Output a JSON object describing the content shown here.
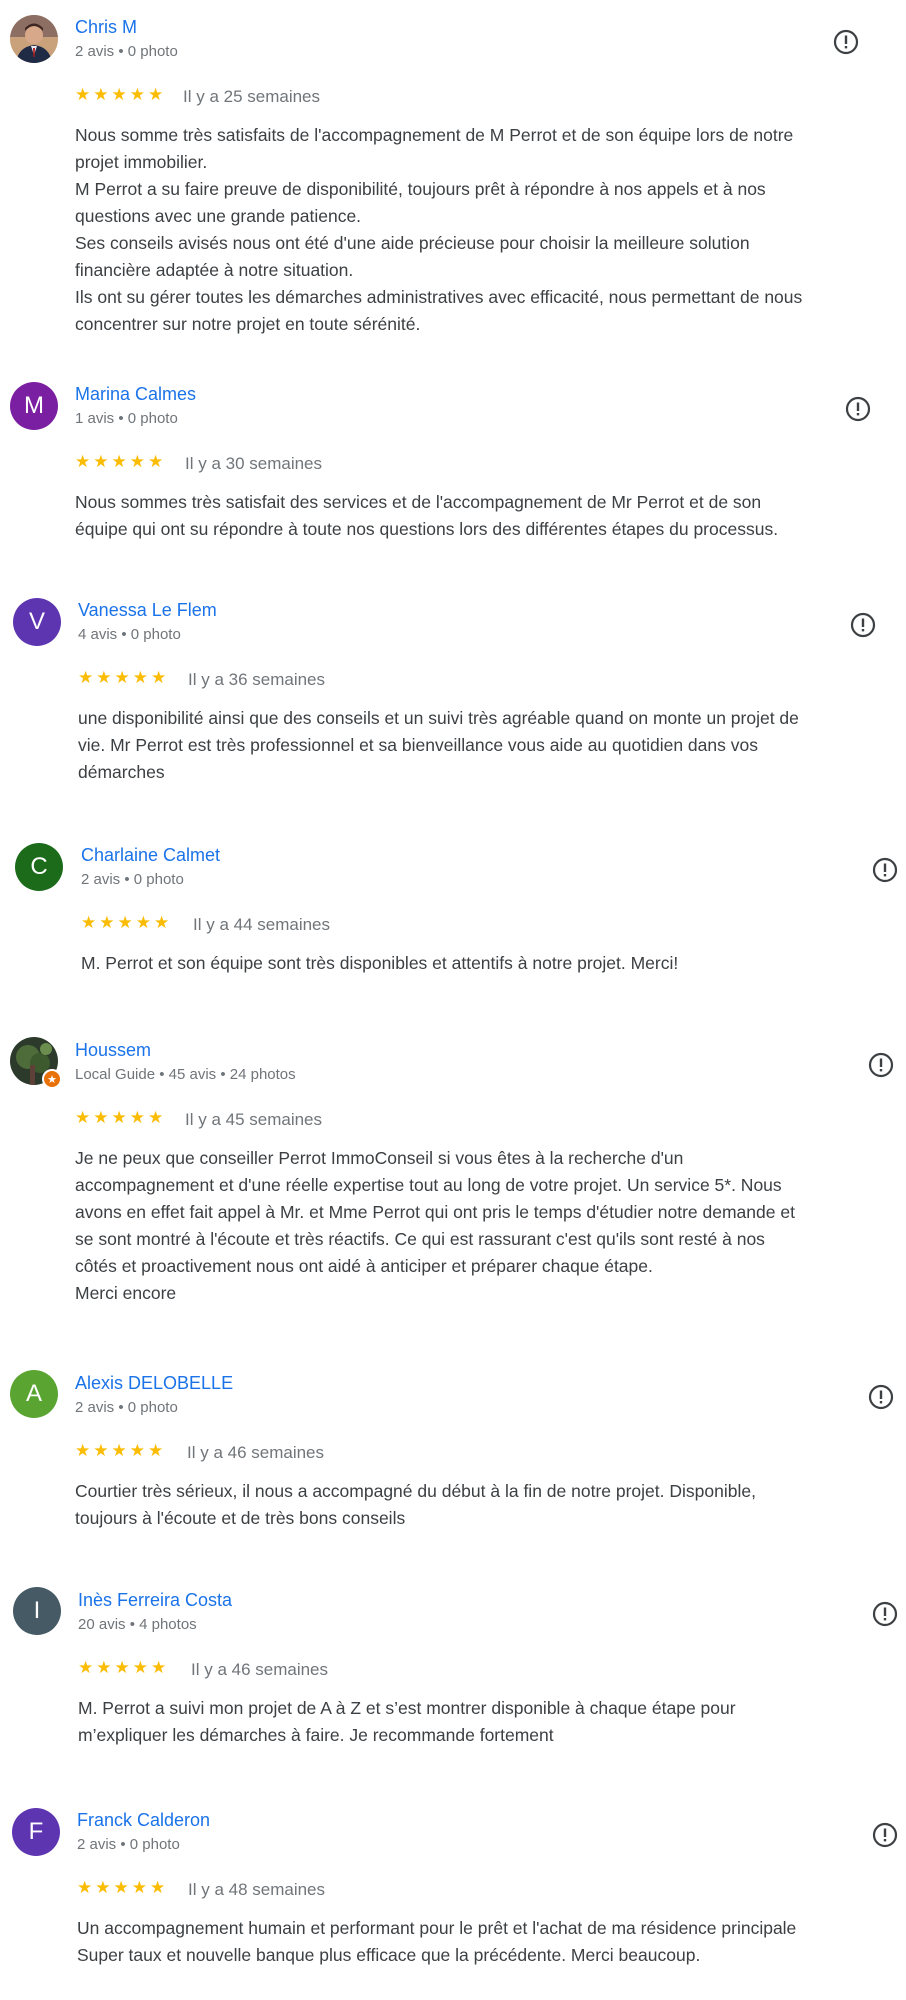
{
  "reviews": [
    {
      "avatar_letter": "",
      "avatar_color": "#5f6368",
      "name": "Chris M",
      "meta": "2 avis • 0 photo",
      "stars": "★★★★★",
      "date": "Il y a 25 semaines",
      "lines": [
        "Nous somme très satisfaits de l'accompagnement de M Perrot et de son équipe lors de notre",
        "projet immobilier.",
        "M Perrot a su faire preuve de disponibilité, toujours prêt à répondre à nos appels et à nos",
        "questions avec une grande patience.",
        "Ses conseils avisés nous ont été d'une aide précieuse pour choisir la meilleure solution",
        "financière adaptée à notre situation.",
        "Ils ont su gérer toutes les démarches administratives avec efficacité, nous permettant de nous",
        "concentrer sur notre projet en toute sérénité."
      ]
    },
    {
      "avatar_letter": "M",
      "avatar_color": "#7b1fa2",
      "name": "Marina Calmes",
      "meta": "1 avis • 0 photo",
      "stars": "★★★★★",
      "date": "Il y a 30 semaines",
      "lines": [
        "Nous sommes très satisfait des services et de l'accompagnement de Mr Perrot et de son",
        "équipe qui ont su répondre à toute nos questions lors des différentes étapes du processus."
      ]
    },
    {
      "avatar_letter": "V",
      "avatar_color": "#5e35b1",
      "name": "Vanessa Le Flem",
      "meta": "4 avis • 0 photo",
      "stars": "★★★★★",
      "date": "Il y a 36 semaines",
      "lines": [
        "une disponibilité ainsi que des conseils et un suivi très agréable quand on monte un projet de",
        "vie. Mr Perrot est très professionnel et sa bienveillance vous aide au quotidien dans vos",
        "démarches"
      ]
    },
    {
      "avatar_letter": "C",
      "avatar_color": "#1b6b1b",
      "name": "Charlaine Calmet",
      "meta": "2 avis • 0 photo",
      "stars": "★★★★★",
      "date": "Il y a 44 semaines",
      "lines": [
        "M. Perrot et son équipe sont très disponibles et attentifs à notre projet. Merci!"
      ]
    },
    {
      "avatar_letter": "",
      "avatar_color": "#2e3b2e",
      "name": "Houssem",
      "meta": "Local Guide • 45 avis • 24 photos",
      "stars": "★★★★★",
      "date": "Il y a 45 semaines",
      "lines": [
        "Je ne peux que conseiller Perrot ImmoConseil si vous êtes à la recherche d'un",
        "accompagnement et d'une réelle expertise tout au long de votre projet. Un service 5*. Nous",
        "avons en effet fait appel à Mr. et Mme Perrot qui ont pris le temps d'étudier notre demande et",
        "se sont montré à l'écoute et très réactifs. Ce qui est rassurant c'est qu'ils sont resté à nos",
        "côtés et proactivement nous ont aidé à anticiper et préparer chaque étape.",
        "Merci encore"
      ]
    },
    {
      "avatar_letter": "A",
      "avatar_color": "#5aa531",
      "name": "Alexis DELOBELLE",
      "meta": "2 avis • 0 photo",
      "stars": "★★★★★",
      "date": "Il y a 46 semaines",
      "lines": [
        "Courtier très sérieux, il nous a accompagné du début à la fin de notre projet. Disponible,",
        "toujours à l'écoute et de très bons conseils"
      ]
    },
    {
      "avatar_letter": "I",
      "avatar_color": "#455a64",
      "name": "Inès Ferreira Costa",
      "meta": "20 avis • 4 photos",
      "stars": "★★★★★",
      "date": "Il y a 46 semaines",
      "lines": [
        "M. Perrot a suivi mon projet de A à Z et s’est montrer disponible à chaque étape pour",
        "m’expliquer les démarches à faire. Je recommande fortement"
      ]
    },
    {
      "avatar_letter": "F",
      "avatar_color": "#5e35b1",
      "name": "Franck Calderon",
      "meta": "2 avis • 0 photo",
      "stars": "★★★★★",
      "date": "Il y a 48 semaines",
      "lines": [
        "Un accompagnement humain et performant pour le prêt et l'achat de ma résidence principale",
        "Super taux et nouvelle banque plus efficace que la précédente. Merci beaucoup."
      ]
    }
  ]
}
